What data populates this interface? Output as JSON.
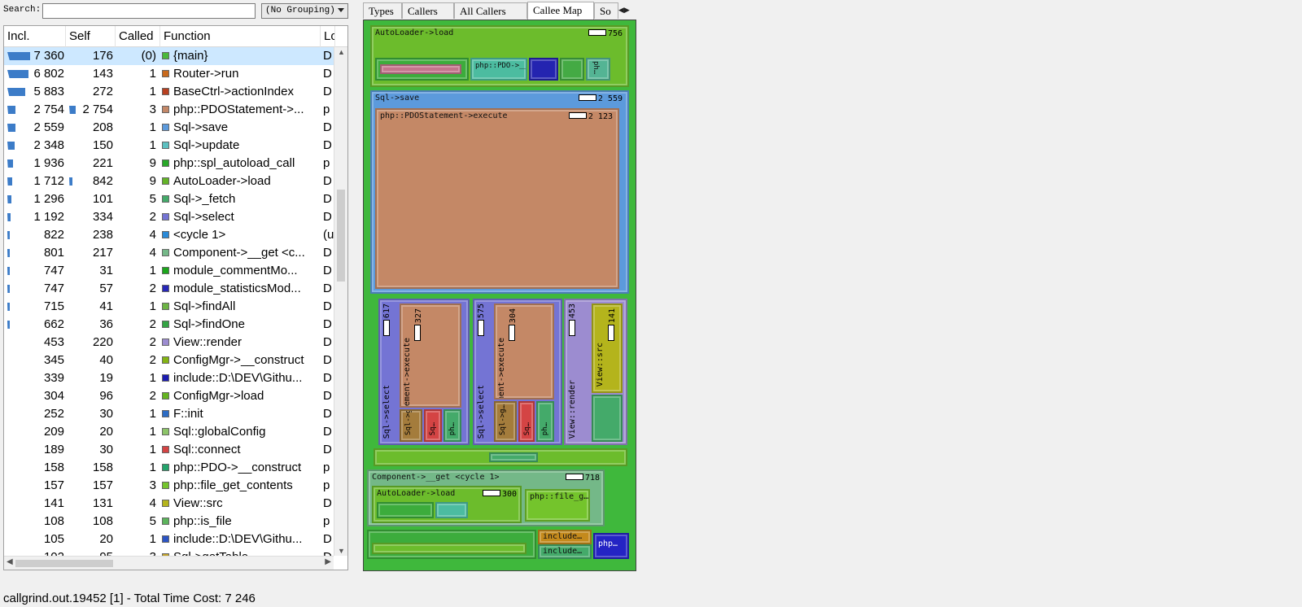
{
  "search_label": "Search:",
  "search_value": "",
  "grouping": "(No Grouping)",
  "columns": [
    "Incl.",
    "Self",
    "Called",
    "Function",
    "Lo"
  ],
  "rows": [
    {
      "incl": "7 360",
      "self": "176",
      "called": "(0)",
      "func": "{main}",
      "loc": "D",
      "color": "#49b83a",
      "bar": 1.0,
      "selbar": 0
    },
    {
      "incl": "6 802",
      "self": "143",
      "called": "1",
      "func": "Router->run",
      "loc": "D",
      "color": "#c8691c",
      "bar": 0.92,
      "selbar": 0
    },
    {
      "incl": "5 883",
      "self": "272",
      "called": "1",
      "func": "BaseCtrl->actionIndex",
      "loc": "D",
      "color": "#b84020",
      "bar": 0.8,
      "selbar": 0
    },
    {
      "incl": "2 754",
      "self": "2 754",
      "called": "3",
      "func": "php::PDOStatement->...",
      "loc": "p",
      "color": "#c48868",
      "bar": 0.37,
      "selbar": 0.37
    },
    {
      "incl": "2 559",
      "self": "208",
      "called": "1",
      "func": "Sql->save",
      "loc": "D",
      "color": "#5c9adc",
      "bar": 0.35,
      "selbar": 0
    },
    {
      "incl": "2 348",
      "self": "150",
      "called": "1",
      "func": "Sql->update",
      "loc": "D",
      "color": "#5cc0c0",
      "bar": 0.32,
      "selbar": 0
    },
    {
      "incl": "1 936",
      "self": "221",
      "called": "9",
      "func": "php::spl_autoload_call",
      "loc": "p",
      "color": "#28a828",
      "bar": 0.26,
      "selbar": 0
    },
    {
      "incl": "1 712",
      "self": "842",
      "called": "9",
      "func": "AutoLoader->load",
      "loc": "D",
      "color": "#64b428",
      "bar": 0.23,
      "selbar": 0.11
    },
    {
      "incl": "1 296",
      "self": "101",
      "called": "5",
      "func": "Sql->_fetch",
      "loc": "D",
      "color": "#44aa6a",
      "bar": 0.18,
      "selbar": 0
    },
    {
      "incl": "1 192",
      "self": "334",
      "called": "2",
      "func": "Sql->select",
      "loc": "D",
      "color": "#7474d4",
      "bar": 0.16,
      "selbar": 0
    },
    {
      "incl": "822",
      "self": "238",
      "called": "4",
      "func": "<cycle 1>",
      "loc": "(u",
      "color": "#2a8ad8",
      "bar": 0.11,
      "selbar": 0
    },
    {
      "incl": "801",
      "self": "217",
      "called": "4",
      "func": "Component->__get <c...",
      "loc": "D",
      "color": "#74b888",
      "bar": 0.11,
      "selbar": 0
    },
    {
      "incl": "747",
      "self": "31",
      "called": "1",
      "func": "module_commentMo...",
      "loc": "D",
      "color": "#1ca61c",
      "bar": 0.1,
      "selbar": 0
    },
    {
      "incl": "747",
      "self": "57",
      "called": "2",
      "func": "module_statisticsMod...",
      "loc": "D",
      "color": "#2828b8",
      "bar": 0.1,
      "selbar": 0
    },
    {
      "incl": "715",
      "self": "41",
      "called": "1",
      "func": "Sql->findAll",
      "loc": "D",
      "color": "#6cb444",
      "bar": 0.1,
      "selbar": 0
    },
    {
      "incl": "662",
      "self": "36",
      "called": "2",
      "func": "Sql->findOne",
      "loc": "D",
      "color": "#34a444",
      "bar": 0.09,
      "selbar": 0
    },
    {
      "incl": "453",
      "self": "220",
      "called": "2",
      "func": "View::render",
      "loc": "D",
      "color": "#9c8cd0",
      "bar": 0,
      "selbar": 0
    },
    {
      "incl": "345",
      "self": "40",
      "called": "2",
      "func": "ConfigMgr->__construct",
      "loc": "D",
      "color": "#84b414",
      "bar": 0,
      "selbar": 0
    },
    {
      "incl": "339",
      "self": "19",
      "called": "1",
      "func": "include::D:\\DEV\\Githu...",
      "loc": "D",
      "color": "#1c1cb0",
      "bar": 0,
      "selbar": 0
    },
    {
      "incl": "304",
      "self": "96",
      "called": "2",
      "func": "ConfigMgr->load",
      "loc": "D",
      "color": "#64b420",
      "bar": 0,
      "selbar": 0
    },
    {
      "incl": "252",
      "self": "30",
      "called": "1",
      "func": "F::init",
      "loc": "D",
      "color": "#2c6cc4",
      "bar": 0,
      "selbar": 0
    },
    {
      "incl": "209",
      "self": "20",
      "called": "1",
      "func": "Sql::globalConfig",
      "loc": "D",
      "color": "#8cc468",
      "bar": 0,
      "selbar": 0
    },
    {
      "incl": "189",
      "self": "30",
      "called": "1",
      "func": "Sql::connect",
      "loc": "D",
      "color": "#d44444",
      "bar": 0,
      "selbar": 0
    },
    {
      "incl": "158",
      "self": "158",
      "called": "1",
      "func": "php::PDO->__construct",
      "loc": "p",
      "color": "#24a46c",
      "bar": 0,
      "selbar": 0
    },
    {
      "incl": "157",
      "self": "157",
      "called": "3",
      "func": "php::file_get_contents",
      "loc": "p",
      "color": "#74c42c",
      "bar": 0,
      "selbar": 0
    },
    {
      "incl": "141",
      "self": "131",
      "called": "4",
      "func": "View::src",
      "loc": "D",
      "color": "#b4b41c",
      "bar": 0,
      "selbar": 0
    },
    {
      "incl": "108",
      "self": "108",
      "called": "5",
      "func": "php::is_file",
      "loc": "p",
      "color": "#5cb45c",
      "bar": 0,
      "selbar": 0
    },
    {
      "incl": "105",
      "self": "20",
      "called": "1",
      "func": "include::D:\\DEV\\Githu...",
      "loc": "D",
      "color": "#2c54c4",
      "bar": 0,
      "selbar": 0
    },
    {
      "incl": "102",
      "self": "95",
      "called": "3",
      "func": "Sql->getTable",
      "loc": "D",
      "color": "#c4a42c",
      "bar": 0,
      "selbar": 0
    }
  ],
  "status": "callgrind.out.19452 [1] - Total Time Cost: 7 246",
  "tabs": [
    "Types",
    "Callers",
    "All Callers",
    "Callee Map",
    "So"
  ],
  "active_tab": "Callee Map",
  "treemap": {
    "autoloader_top": {
      "label": "AutoLoader->load",
      "cost": "756"
    },
    "pdo_cons": "php::PDO->__cons…",
    "ph_small": "ph…",
    "sql_save": {
      "label": "Sql->save",
      "cost": "2 559"
    },
    "pdo_exec": {
      "label": "php::PDOStatement->execute",
      "cost": "2 123"
    },
    "select1": {
      "label": "Sql->select",
      "cost": "617"
    },
    "pdo_v1": {
      "label": "php::PDOStatement->execute",
      "cost": "327"
    },
    "select2": {
      "label": "Sql->select",
      "cost": "575"
    },
    "pdo_v2": {
      "label": "php::PDOStatement->execute",
      "cost": "304"
    },
    "view_render": {
      "label": "View::render",
      "cost": "453"
    },
    "view_src": {
      "label": "View::src",
      "cost": "141"
    },
    "sql_g": "Sql->g…",
    "sq": "Sq…",
    "ph": "ph…",
    "component_get": {
      "label": "Component->__get <cycle 1>",
      "cost": "718"
    },
    "autoloader_mid": {
      "label": "AutoLoader->load",
      "cost": "300"
    },
    "file_g": "php::file_g…",
    "include1": "include…",
    "include2": "include…",
    "php_small": "php…"
  }
}
